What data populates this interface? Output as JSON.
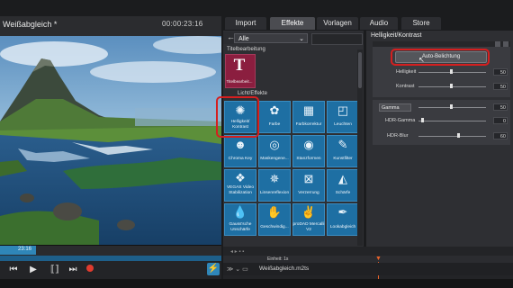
{
  "preview": {
    "title": "Weißabgleich *",
    "timecode": "00:00:23:16",
    "position_marker": "23:16"
  },
  "transport": {
    "buttons": [
      "skip-start",
      "play",
      "loop",
      "skip-end",
      "record",
      "bolt"
    ]
  },
  "tabs": [
    {
      "label": "Import",
      "active": false
    },
    {
      "label": "Effekte",
      "active": true
    },
    {
      "label": "Vorlagen",
      "active": false
    },
    {
      "label": "Audio",
      "active": false
    },
    {
      "label": "Store",
      "active": false
    }
  ],
  "effects": {
    "category": "Alle",
    "section_title": "Titelbearbeitung",
    "section_light": "Licht/Effekte",
    "title_tile_label": "Titelbearbeit...",
    "tiles": [
      {
        "label": "Helligkeit/ Kontrast",
        "icon": "sun-icon"
      },
      {
        "label": "Farbe",
        "icon": "palette-icon"
      },
      {
        "label": "Farbkorrektur",
        "icon": "levels-icon"
      },
      {
        "label": "Leuchten",
        "icon": "glow-icon"
      },
      {
        "label": "Chroma Key",
        "icon": "person-icon"
      },
      {
        "label": "Maskengene...",
        "icon": "mask-icon"
      },
      {
        "label": "Stanzformen",
        "icon": "stamp-icon"
      },
      {
        "label": "Kunstfilter",
        "icon": "art-icon"
      },
      {
        "label": "VEGAS Video Stabilization",
        "icon": "stabilize-icon"
      },
      {
        "label": "Linsenreflexion",
        "icon": "lens-icon"
      },
      {
        "label": "Verzerrung",
        "icon": "distort-icon"
      },
      {
        "label": "Schärfe",
        "icon": "sharpen-icon"
      },
      {
        "label": "Gauss'sche Unschärfe",
        "icon": "drop-icon"
      },
      {
        "label": "Geschwindig...",
        "icon": "hand-icon"
      },
      {
        "label": "proDAD Mercalli V2",
        "icon": "hand-raise-icon"
      },
      {
        "label": "Lookabgleich",
        "icon": "dropper-icon"
      }
    ]
  },
  "properties": {
    "title": "Helligkeit/Kontrast",
    "auto_button": "Auto-Belichtung",
    "rows": [
      {
        "label": "Helligkeit",
        "value": "50"
      },
      {
        "label": "Kontrast",
        "value": "50"
      }
    ],
    "gamma_select": "Gamma",
    "gamma_value": "50",
    "hdr_gamma_label": "HDR-Gamma",
    "hdr_gamma_value": "0",
    "hdr_blur_label": "HDR-Blur",
    "hdr_blur_value": "60"
  },
  "timeline": {
    "unit_label": "Einheit: 1s",
    "track_file": "Weißabgleich.m2ts"
  },
  "colors": {
    "accent": "#2f86b8",
    "tile": "#1e6fa3",
    "highlight": "#d51f1f",
    "title_tile": "#8b1e3f"
  }
}
